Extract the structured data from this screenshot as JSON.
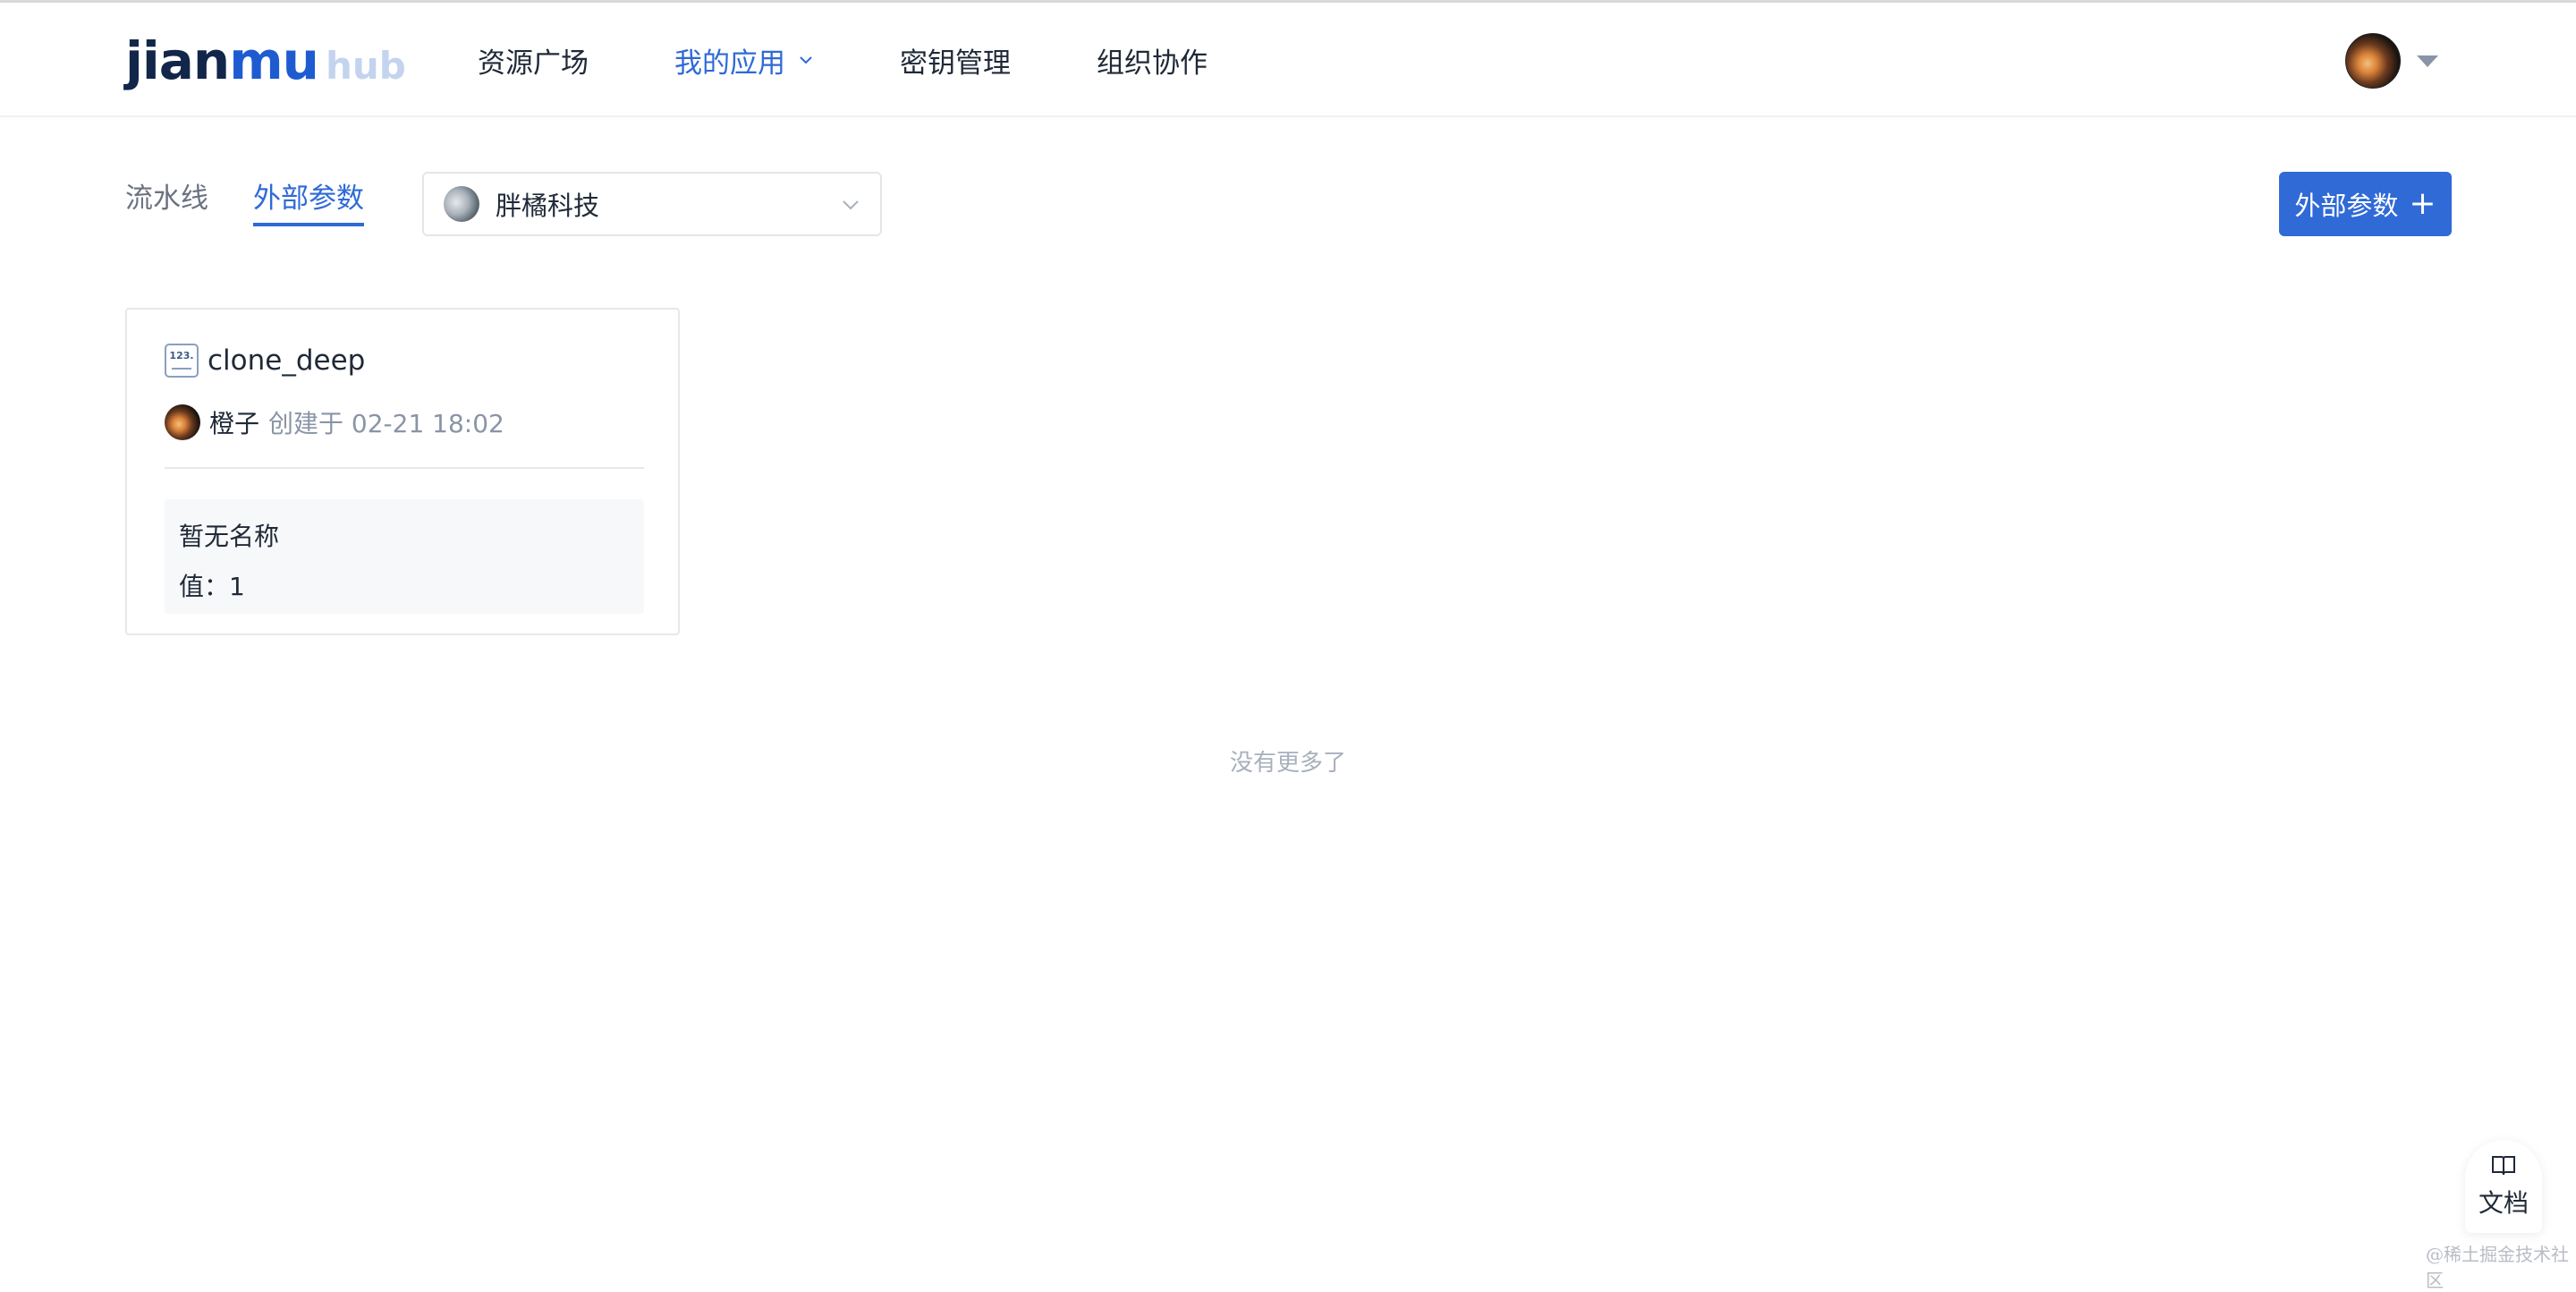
{
  "header": {
    "logo_main": "jian",
    "logo_accent": "mu",
    "logo_sub": "hub",
    "nav": [
      {
        "label": "资源广场",
        "active": false
      },
      {
        "label": "我的应用",
        "active": true,
        "has_dropdown": true
      },
      {
        "label": "密钥管理",
        "active": false
      },
      {
        "label": "组织协作",
        "active": false
      }
    ]
  },
  "toolbar": {
    "tabs": [
      {
        "label": "流水线",
        "active": false
      },
      {
        "label": "外部参数",
        "active": true
      }
    ],
    "org_select": {
      "value": "胖橘科技"
    },
    "add_button": {
      "label": "外部参数",
      "plus": "+"
    }
  },
  "cards": [
    {
      "icon_text": "123.",
      "title": "clone_deep",
      "author": "橙子",
      "created": "创建于 02-21 18:02",
      "display_name": "暂无名称",
      "value_line": "值：1"
    }
  ],
  "list_end": "没有更多了",
  "docs": {
    "label": "文档"
  },
  "watermark": "@稀土掘金技术社区",
  "colors": {
    "primary": "#2f6ad6",
    "logo_dark": "#12264a",
    "logo_hub": "#c4d4ef"
  }
}
